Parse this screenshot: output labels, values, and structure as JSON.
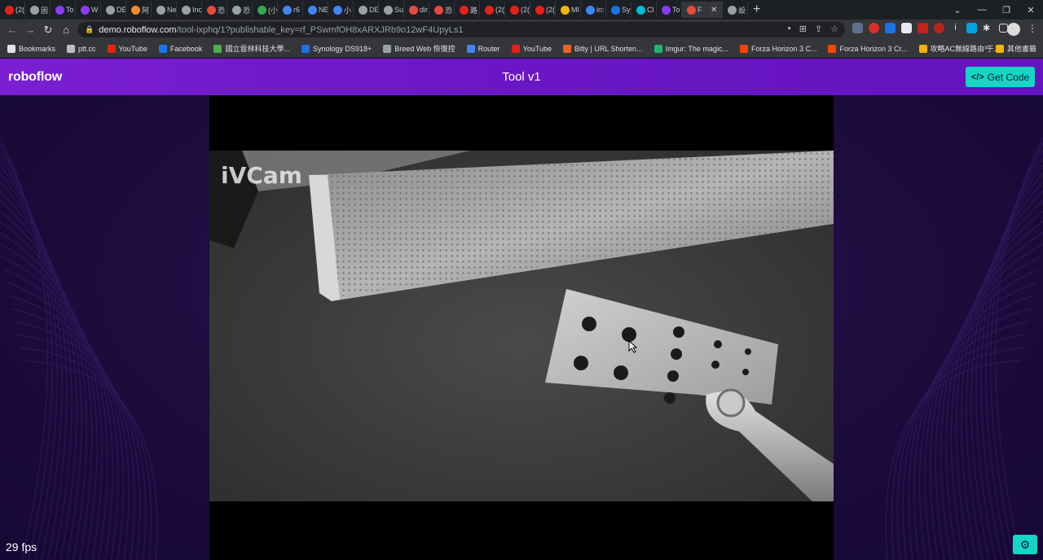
{
  "browser": {
    "tabs": [
      {
        "label": "(2(",
        "color": "#e62117"
      },
      {
        "label": "固",
        "color": "#9aa0a6"
      },
      {
        "label": "To",
        "color": "#8b3cf2"
      },
      {
        "label": "W",
        "color": "#8b3cf2"
      },
      {
        "label": "DE",
        "color": "#9aa0a6"
      },
      {
        "label": "阿",
        "color": "#f08c2a"
      },
      {
        "label": "Ne",
        "color": "#9aa0a6"
      },
      {
        "label": "Inc",
        "color": "#9aa0a6"
      },
      {
        "label": "恐",
        "color": "#e8493b"
      },
      {
        "label": "恐",
        "color": "#9aa0a6"
      },
      {
        "label": "(小",
        "color": "#34a853"
      },
      {
        "label": "r6",
        "color": "#4285f4"
      },
      {
        "label": "NE",
        "color": "#4285f4"
      },
      {
        "label": "小",
        "color": "#4285f4"
      },
      {
        "label": "DE",
        "color": "#9aa0a6"
      },
      {
        "label": "Su",
        "color": "#9aa0a6"
      },
      {
        "label": "dir",
        "color": "#e8493b"
      },
      {
        "label": "恐",
        "color": "#e8493b"
      },
      {
        "label": "路",
        "color": "#e62117"
      },
      {
        "label": "(2(",
        "color": "#e62117"
      },
      {
        "label": "(2(",
        "color": "#e62117"
      },
      {
        "label": "(2(",
        "color": "#e62117"
      },
      {
        "label": "MI",
        "color": "#f4b400"
      },
      {
        "label": "in:",
        "color": "#4285f4"
      },
      {
        "label": "Sy",
        "color": "#1a73e8"
      },
      {
        "label": "Cl",
        "color": "#00bcd4"
      },
      {
        "label": "To",
        "color": "#8b3cf2"
      }
    ],
    "active_tab": {
      "label": "F",
      "close": "✕"
    },
    "extra_tab": {
      "label": "設",
      "color": "#9aa0a6"
    },
    "new_tab": "+",
    "window_controls": [
      "⌄",
      "—",
      "❐",
      "✕"
    ],
    "url": {
      "host": "demo.roboflow.com",
      "path": "/tool-ixphq/1?publishable_key=rf_PSwmfOH8xARXJRb9o12wF4UpyLs1"
    },
    "bookmarks": [
      {
        "label": "Bookmarks",
        "icon": "star-icon",
        "color": "#e3e3e3"
      },
      {
        "label": "ptt.cc",
        "icon": "ptt-icon",
        "color": "#bdbdbd"
      },
      {
        "label": "YouTube",
        "icon": "youtube-icon",
        "color": "#e62117"
      },
      {
        "label": "Facebook",
        "icon": "facebook-icon",
        "color": "#1877f2"
      },
      {
        "label": "國立雲林科技大學...",
        "icon": "school-icon",
        "color": "#4caf50"
      },
      {
        "label": "Synology DS918+",
        "icon": "synology-icon",
        "color": "#1a73e8"
      },
      {
        "label": "Breed Web 恢復控",
        "icon": "globe-icon",
        "color": "#9aa0a6"
      },
      {
        "label": "Router",
        "icon": "router-icon",
        "color": "#4285f4"
      },
      {
        "label": "YouTube",
        "icon": "youtube-icon",
        "color": "#e62117"
      },
      {
        "label": "Bitly | URL Shorten...",
        "icon": "bitly-icon",
        "color": "#ee6123"
      },
      {
        "label": "Imgur: The magic...",
        "icon": "imgur-icon",
        "color": "#1bb76e"
      },
      {
        "label": "Forza Horizon 3 C...",
        "icon": "reddit-icon",
        "color": "#ff4500"
      },
      {
        "label": "Forza Horizon 3 Cr...",
        "icon": "reddit-icon",
        "color": "#ff4500"
      },
      {
        "label": "攻略AC無線路由 于...",
        "icon": "router-icon",
        "color": "#f4b400"
      }
    ],
    "bookmarks_more": "»",
    "other_bookmarks": "其他書籤"
  },
  "app": {
    "logo": "roboflow",
    "title": "Tool v1",
    "get_code_label": "Get Code",
    "watermark": "iVCam",
    "fps": "29 fps",
    "accent": "#14d6c4",
    "header_color": "#6a16c4"
  }
}
